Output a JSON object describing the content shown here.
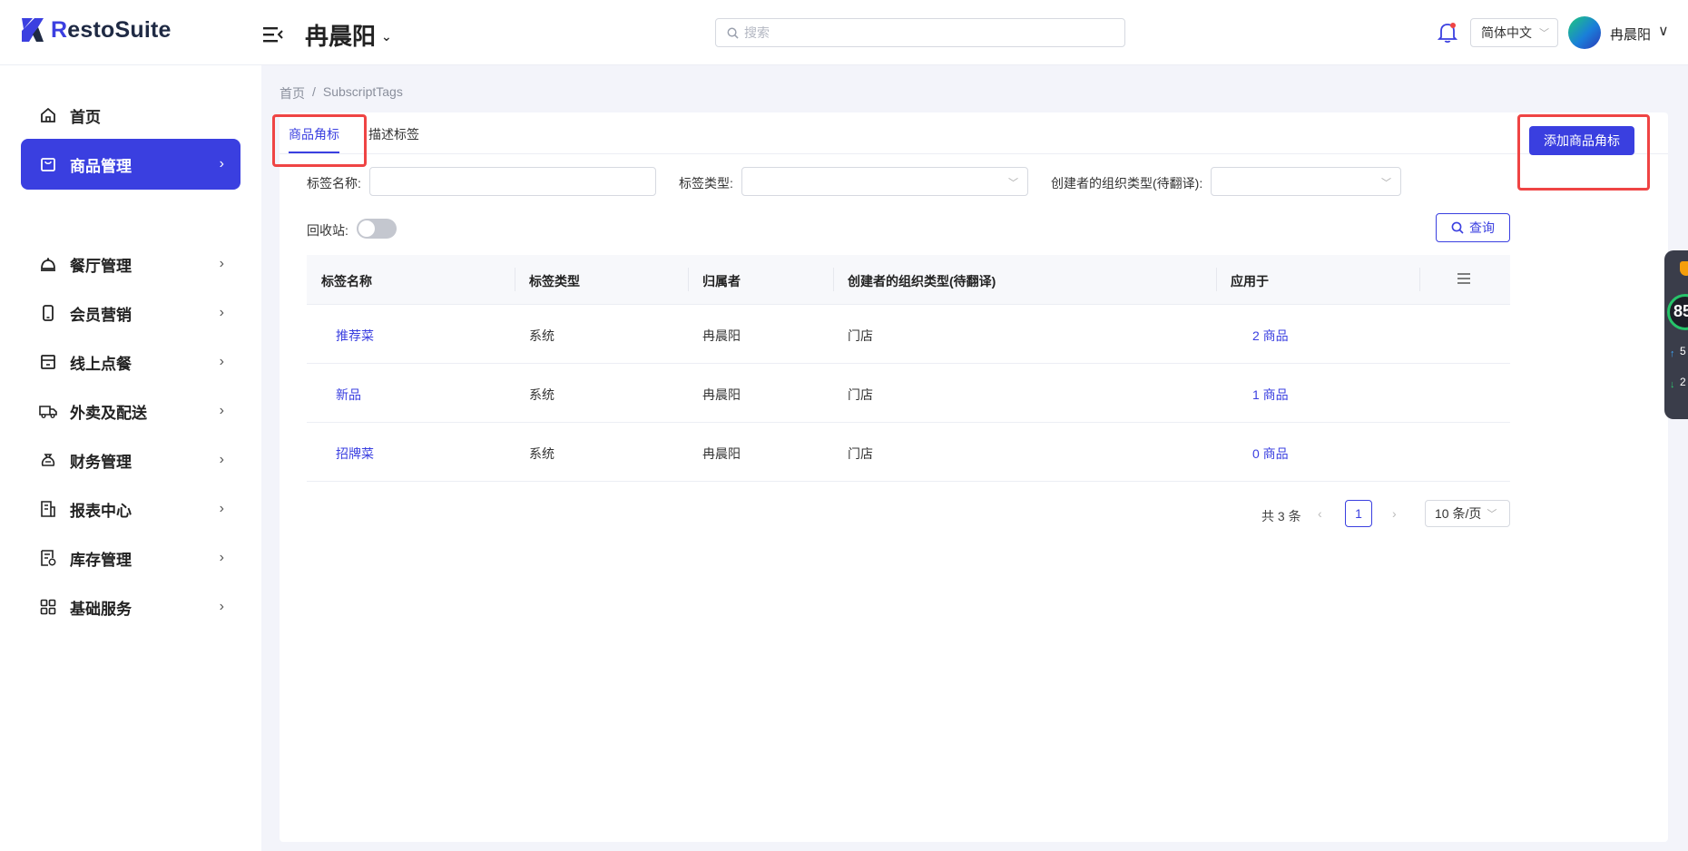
{
  "app": {
    "brand_prefix": "R",
    "brand_rest": "estoSuite",
    "org_name": "冉晨阳",
    "search_placeholder": "搜索",
    "language": "简体中文",
    "user_name": "冉晨阳",
    "accent_color": "#3a3fe0"
  },
  "sidebar": {
    "items": [
      {
        "label": "首页",
        "icon": "home-icon",
        "active": false,
        "has_children": false
      },
      {
        "label": "商品管理",
        "icon": "shopping-bag-icon",
        "active": true,
        "has_children": true
      },
      {
        "label": "餐厅管理",
        "icon": "cloche-icon",
        "active": false,
        "has_children": true
      },
      {
        "label": "会员营销",
        "icon": "mobile-icon",
        "active": false,
        "has_children": true
      },
      {
        "label": "线上点餐",
        "icon": "store-icon",
        "active": false,
        "has_children": true
      },
      {
        "label": "外卖及配送",
        "icon": "truck-icon",
        "active": false,
        "has_children": true
      },
      {
        "label": "财务管理",
        "icon": "money-bag-icon",
        "active": false,
        "has_children": true
      },
      {
        "label": "报表中心",
        "icon": "report-icon",
        "active": false,
        "has_children": true
      },
      {
        "label": "库存管理",
        "icon": "inventory-icon",
        "active": false,
        "has_children": true
      },
      {
        "label": "基础服务",
        "icon": "grid-icon",
        "active": false,
        "has_children": true
      }
    ]
  },
  "breadcrumb": {
    "home": "首页",
    "separator": "/",
    "current": "SubscriptTags"
  },
  "tabs": {
    "items": [
      "商品角标",
      "描述标签"
    ],
    "active_index": 0
  },
  "actions": {
    "add_label": "添加商品角标",
    "query_label": "查询"
  },
  "filters": {
    "tag_name_label": "标签名称:",
    "tag_name_value": "",
    "tag_type_label": "标签类型:",
    "tag_type_value": "",
    "org_type_label": "创建者的组织类型(待翻译):",
    "org_type_value": "",
    "recycle_label": "回收站:",
    "recycle_on": false
  },
  "table": {
    "columns": [
      "标签名称",
      "标签类型",
      "归属者",
      "创建者的组织类型(待翻译)",
      "应用于"
    ],
    "rows": [
      {
        "name": "推荐菜",
        "type": "系统",
        "owner": "冉晨阳",
        "org_type": "门店",
        "applied": "2 商品"
      },
      {
        "name": "新品",
        "type": "系统",
        "owner": "冉晨阳",
        "org_type": "门店",
        "applied": "1 商品"
      },
      {
        "name": "招牌菜",
        "type": "系统",
        "owner": "冉晨阳",
        "org_type": "门店",
        "applied": "0 商品"
      }
    ]
  },
  "pagination": {
    "total_text": "共 3 条",
    "current_page": "1",
    "page_size": "10 条/页"
  },
  "widget": {
    "score": "85",
    "line1": "5",
    "line2": "2"
  }
}
